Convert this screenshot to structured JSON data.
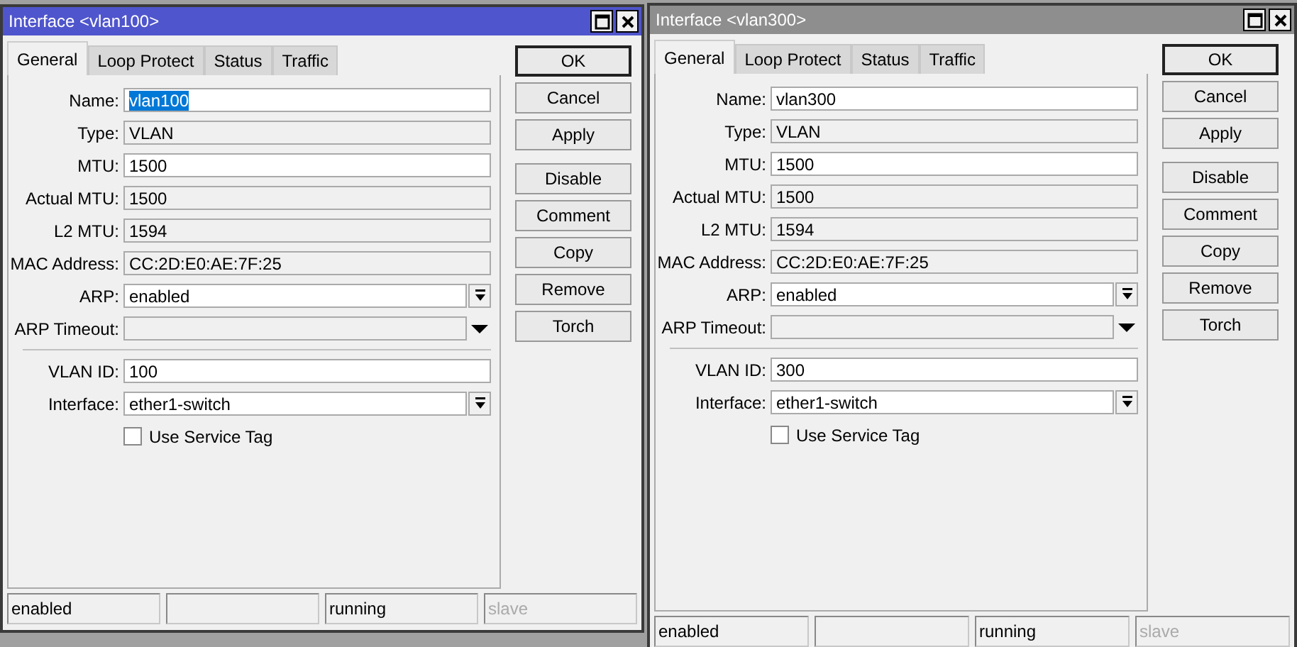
{
  "windows": [
    {
      "title": "Interface <vlan100>",
      "active": true,
      "tabs": [
        {
          "label": "General",
          "selected": true
        },
        {
          "label": "Loop Protect",
          "selected": false
        },
        {
          "label": "Status",
          "selected": false
        },
        {
          "label": "Traffic",
          "selected": false
        }
      ],
      "field_groups": [
        [
          {
            "kind": "text",
            "label": "Name:",
            "value": "vlan100",
            "text_selected": true
          },
          {
            "kind": "readonly",
            "label": "Type:",
            "value": "VLAN"
          },
          {
            "kind": "text",
            "label": "MTU:",
            "value": "1500",
            "text_selected": false
          },
          {
            "kind": "readonly",
            "label": "Actual MTU:",
            "value": "1500"
          },
          {
            "kind": "readonly",
            "label": "L2 MTU:",
            "value": "1594"
          },
          {
            "kind": "readonly",
            "label": "MAC Address:",
            "value": "CC:2D:E0:AE:7F:25"
          },
          {
            "kind": "dropdown",
            "label": "ARP:",
            "value": "enabled"
          },
          {
            "kind": "dropdown-disabled",
            "label": "ARP Timeout:"
          }
        ],
        [
          {
            "kind": "text",
            "label": "VLAN ID:",
            "value": "100",
            "text_selected": false
          },
          {
            "kind": "dropdown",
            "label": "Interface:",
            "value": "ether1-switch"
          },
          {
            "kind": "checkbox",
            "label": "Use Service Tag",
            "checked": false
          }
        ]
      ],
      "button_groups": [
        [
          {
            "label": "OK",
            "default": true
          },
          {
            "label": "Cancel",
            "default": false
          },
          {
            "label": "Apply",
            "default": false
          }
        ],
        [
          {
            "label": "Disable",
            "default": false
          },
          {
            "label": "Comment",
            "default": false
          },
          {
            "label": "Copy",
            "default": false
          },
          {
            "label": "Remove",
            "default": false
          },
          {
            "label": "Torch",
            "default": false
          }
        ]
      ],
      "status_bar": [
        {
          "kind": "text",
          "text": "enabled",
          "disabled": false
        },
        {
          "kind": "empty"
        },
        {
          "kind": "text",
          "text": "running",
          "disabled": false
        },
        {
          "kind": "text",
          "text": "slave",
          "disabled": true
        }
      ]
    },
    {
      "title": "Interface <vlan300>",
      "active": false,
      "tabs": [
        {
          "label": "General",
          "selected": true
        },
        {
          "label": "Loop Protect",
          "selected": false
        },
        {
          "label": "Status",
          "selected": false
        },
        {
          "label": "Traffic",
          "selected": false
        }
      ],
      "field_groups": [
        [
          {
            "kind": "text",
            "label": "Name:",
            "value": "vlan300",
            "text_selected": false
          },
          {
            "kind": "readonly",
            "label": "Type:",
            "value": "VLAN"
          },
          {
            "kind": "text",
            "label": "MTU:",
            "value": "1500",
            "text_selected": false
          },
          {
            "kind": "readonly",
            "label": "Actual MTU:",
            "value": "1500"
          },
          {
            "kind": "readonly",
            "label": "L2 MTU:",
            "value": "1594"
          },
          {
            "kind": "readonly",
            "label": "MAC Address:",
            "value": "CC:2D:E0:AE:7F:25"
          },
          {
            "kind": "dropdown",
            "label": "ARP:",
            "value": "enabled"
          },
          {
            "kind": "dropdown-disabled",
            "label": "ARP Timeout:"
          }
        ],
        [
          {
            "kind": "text",
            "label": "VLAN ID:",
            "value": "300",
            "text_selected": false
          },
          {
            "kind": "dropdown",
            "label": "Interface:",
            "value": "ether1-switch"
          },
          {
            "kind": "checkbox",
            "label": "Use Service Tag",
            "checked": false
          }
        ]
      ],
      "button_groups": [
        [
          {
            "label": "OK",
            "default": true
          },
          {
            "label": "Cancel",
            "default": false
          },
          {
            "label": "Apply",
            "default": false
          }
        ],
        [
          {
            "label": "Disable",
            "default": false
          },
          {
            "label": "Comment",
            "default": false
          },
          {
            "label": "Copy",
            "default": false
          },
          {
            "label": "Remove",
            "default": false
          },
          {
            "label": "Torch",
            "default": false
          }
        ]
      ],
      "status_bar": [
        {
          "kind": "text",
          "text": "enabled",
          "disabled": false
        },
        {
          "kind": "empty"
        },
        {
          "kind": "text",
          "text": "running",
          "disabled": false
        },
        {
          "kind": "text",
          "text": "slave",
          "disabled": true
        }
      ]
    }
  ]
}
